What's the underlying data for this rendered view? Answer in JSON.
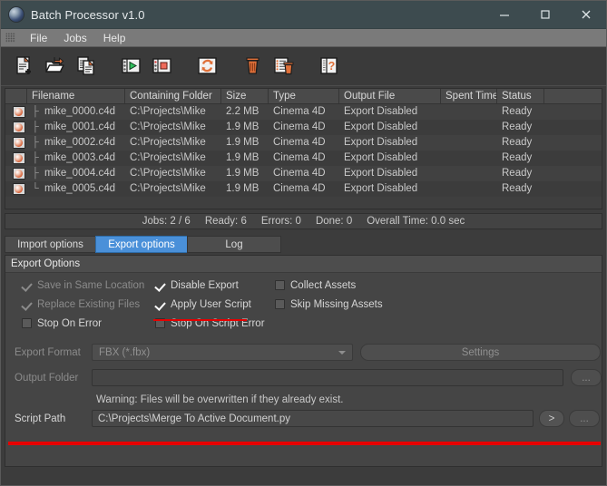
{
  "window": {
    "title": "Batch Processor v1.0",
    "logo_icon": "app-sphere-icon",
    "controls": [
      {
        "name": "minimize-button",
        "icon": "minimize-icon"
      },
      {
        "name": "maximize-button",
        "icon": "maximize-icon"
      },
      {
        "name": "close-button",
        "icon": "close-icon"
      }
    ]
  },
  "menubar": {
    "grip_icon": "drag-grip-icon",
    "items": [
      {
        "label": "File"
      },
      {
        "label": "Jobs"
      },
      {
        "label": "Help"
      }
    ]
  },
  "toolbar": {
    "buttons": [
      {
        "name": "add-job-button",
        "icon": "document-add-icon"
      },
      {
        "name": "open-folder-button",
        "icon": "folder-open-icon"
      },
      {
        "name": "duplicate-job-button",
        "icon": "documents-copy-icon"
      },
      {
        "name": "start-button",
        "icon": "play-icon"
      },
      {
        "name": "stop-button",
        "icon": "stop-icon"
      },
      {
        "name": "refresh-button",
        "icon": "refresh-cycle-icon"
      },
      {
        "name": "delete-button",
        "icon": "trash-icon"
      },
      {
        "name": "clear-list-button",
        "icon": "list-trash-icon"
      },
      {
        "name": "help-button",
        "icon": "help-question-icon"
      }
    ]
  },
  "table": {
    "columns": [
      "Filename",
      "Containing Folder",
      "Size",
      "Type",
      "Output File",
      "Spent Time",
      "Status"
    ],
    "rows": [
      {
        "icon": "c4d-file-icon",
        "filename": "mike_0000.c4d",
        "folder": "C:\\Projects\\Mike",
        "size": "2.2 MB",
        "type": "Cinema 4D",
        "output": "Export Disabled",
        "spent": "",
        "status": "Ready"
      },
      {
        "icon": "c4d-file-icon",
        "filename": "mike_0001.c4d",
        "folder": "C:\\Projects\\Mike",
        "size": "1.9 MB",
        "type": "Cinema 4D",
        "output": "Export Disabled",
        "spent": "",
        "status": "Ready"
      },
      {
        "icon": "c4d-file-icon",
        "filename": "mike_0002.c4d",
        "folder": "C:\\Projects\\Mike",
        "size": "1.9 MB",
        "type": "Cinema 4D",
        "output": "Export Disabled",
        "spent": "",
        "status": "Ready"
      },
      {
        "icon": "c4d-file-icon",
        "filename": "mike_0003.c4d",
        "folder": "C:\\Projects\\Mike",
        "size": "1.9 MB",
        "type": "Cinema 4D",
        "output": "Export Disabled",
        "spent": "",
        "status": "Ready"
      },
      {
        "icon": "c4d-file-icon",
        "filename": "mike_0004.c4d",
        "folder": "C:\\Projects\\Mike",
        "size": "1.9 MB",
        "type": "Cinema 4D",
        "output": "Export Disabled",
        "spent": "",
        "status": "Ready"
      },
      {
        "icon": "c4d-file-icon",
        "filename": "mike_0005.c4d",
        "folder": "C:\\Projects\\Mike",
        "size": "1.9 MB",
        "type": "Cinema 4D",
        "output": "Export Disabled",
        "spent": "",
        "status": "Ready"
      }
    ]
  },
  "statusbar": {
    "jobs": "Jobs: 2 / 6",
    "ready": "Ready: 6",
    "errors": "Errors: 0",
    "done": "Done: 0",
    "overall_time": "Overall Time: 0.0 sec"
  },
  "tabs": [
    {
      "label": "Import options",
      "active": false
    },
    {
      "label": "Export options",
      "active": true
    },
    {
      "label": "Log",
      "active": false
    }
  ],
  "export_options": {
    "header": "Export Options",
    "checkboxes": [
      {
        "label": "Save in Same Location",
        "checked": true,
        "disabled": true
      },
      {
        "label": "Disable Export",
        "checked": true,
        "disabled": false
      },
      {
        "label": "Collect Assets",
        "checked": false,
        "disabled": false
      },
      {
        "label": "Replace Existing Files",
        "checked": true,
        "disabled": true
      },
      {
        "label": "Apply User Script",
        "checked": true,
        "disabled": false
      },
      {
        "label": "Skip Missing Assets",
        "checked": false,
        "disabled": false
      },
      {
        "label": "Stop On Error",
        "checked": false,
        "disabled": false
      },
      {
        "label": "Stop On Script Error",
        "checked": false,
        "disabled": false
      }
    ],
    "export_format": {
      "label": "Export Format",
      "value": "FBX (*.fbx)",
      "disabled": true
    },
    "settings_button": {
      "label": "Settings",
      "disabled": true
    },
    "output_folder": {
      "label": "Output Folder",
      "value": "",
      "placeholder": "",
      "browse_label": "..."
    },
    "warning": "Warning: Files will be overwritten if they already exist.",
    "script_path": {
      "label": "Script Path",
      "value": "C:\\Projects\\Merge To Active Document.py",
      "run_label": ">",
      "browse_label": "..."
    }
  },
  "annotations": {
    "color": "#e60000",
    "marks": [
      {
        "name": "apply-user-script-underline"
      },
      {
        "name": "script-path-underline"
      }
    ]
  }
}
